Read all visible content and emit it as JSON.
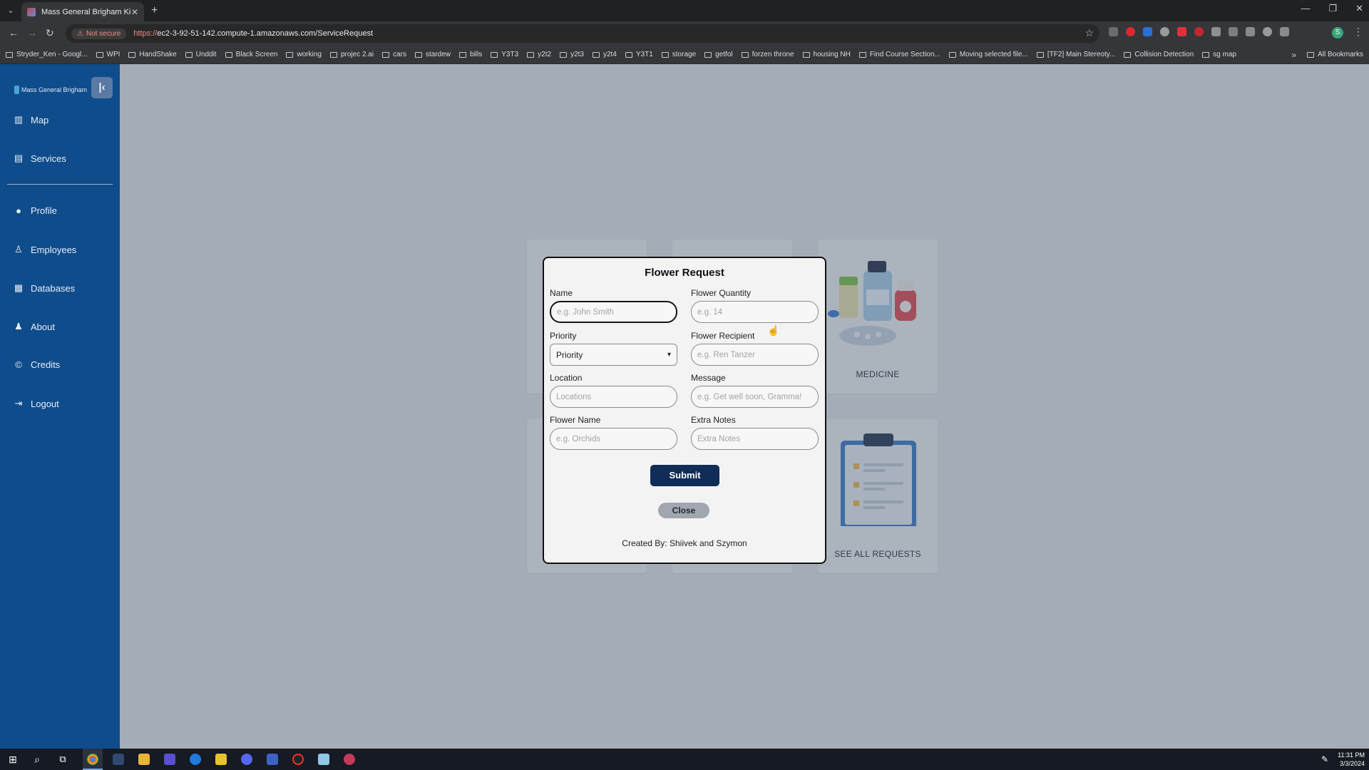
{
  "browser": {
    "tab_title": "Mass General Brigham Kiosk",
    "security_label": "Not secure",
    "url_protocol": "https://",
    "url_host": "ec2-3-92-51-142.compute-1.amazonaws.com/ServiceRequest",
    "bookmarks": [
      "Stryder_Ken - Googl...",
      "WPI",
      "HandShake",
      "Unddit",
      "Black Screen",
      "working",
      "projec 2.ai",
      "cars",
      "stardew",
      "bills",
      "Y3T3",
      "y2t2",
      "y2t3",
      "y2t4",
      "Y3T1",
      "storage",
      "getfol",
      "forzen throne",
      "housing NH",
      "Find Course Section...",
      "Moving selected file...",
      "[TF2] Main Stereoty...",
      "Collision Detection",
      "sg map"
    ],
    "all_bookmarks": "All Bookmarks"
  },
  "sidebar": {
    "brand": "Mass General Brigham",
    "items": [
      {
        "label": "Map",
        "icon": "map-icon"
      },
      {
        "label": "Services",
        "icon": "clipboard-icon"
      },
      {
        "label": "Profile",
        "icon": "profile-icon"
      },
      {
        "label": "Employees",
        "icon": "person-icon"
      },
      {
        "label": "Databases",
        "icon": "table-icon"
      },
      {
        "label": "About",
        "icon": "user-outline-icon"
      },
      {
        "label": "Credits",
        "icon": "copyright-icon"
      },
      {
        "label": "Logout",
        "icon": "logout-icon"
      }
    ]
  },
  "cards": {
    "medicine": "MEDICINE",
    "see_all": "SEE ALL REQUESTS"
  },
  "modal": {
    "title": "Flower Request",
    "fields": {
      "name": {
        "label": "Name",
        "placeholder": "e.g. John Smith"
      },
      "quantity": {
        "label": "Flower Quantity",
        "placeholder": "e.g. 14"
      },
      "priority": {
        "label": "Priority",
        "value": "Priority"
      },
      "recipient": {
        "label": "Flower Recipient",
        "placeholder": "e.g. Ren Tanzer"
      },
      "location": {
        "label": "Location",
        "placeholder": "Locations"
      },
      "message": {
        "label": "Message",
        "placeholder": "e.g. Get well soon, Gramma!"
      },
      "flower_name": {
        "label": "Flower Name",
        "placeholder": "e.g. Orchids"
      },
      "notes": {
        "label": "Extra Notes",
        "placeholder": "Extra Notes"
      }
    },
    "submit": "Submit",
    "close": "Close",
    "credit": "Created By: Shiivek and Szymon"
  },
  "taskbar": {
    "time": "11:31 PM",
    "date": "3/3/2024"
  },
  "colors": {
    "sidebar": "#0f4c8c",
    "submit": "#0f2d57",
    "close": "#a2a6ae"
  }
}
